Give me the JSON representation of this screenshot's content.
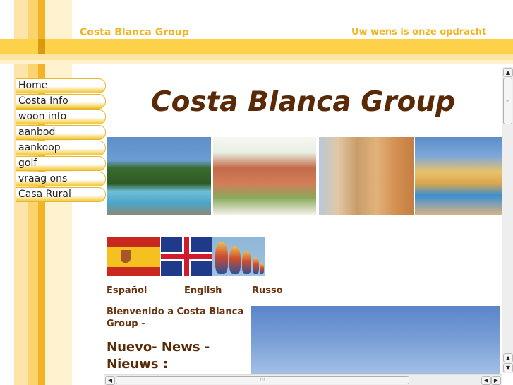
{
  "header": {
    "site_name": "Costa Blanca Group",
    "tagline": "Uw wens is onze opdracht"
  },
  "nav": {
    "items": [
      {
        "label": "Home"
      },
      {
        "label": "Costa Info"
      },
      {
        "label": "woon info"
      },
      {
        "label": "aanbod"
      },
      {
        "label": "aankoop"
      },
      {
        "label": "golf"
      },
      {
        "label": "vraag ons"
      },
      {
        "label": "Casa Rural"
      }
    ]
  },
  "main": {
    "heading": "Costa Blanca Group",
    "languages": {
      "spanish": "Español",
      "english": "English",
      "russian": "Russo"
    },
    "intro": "Bienvenido a Costa Blanca Group -",
    "news_title": "Nuevo- News - Nieuws :"
  },
  "colors": {
    "accent_yellow": "#fdd14a",
    "brand_brown": "#5a2a06",
    "header_text": "#f2b420"
  }
}
